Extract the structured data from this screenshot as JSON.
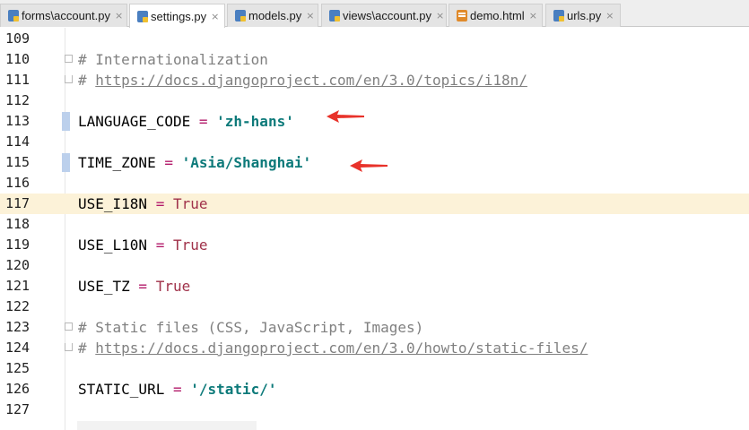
{
  "tabs": [
    {
      "label": "forms\\account.py",
      "icon": "python-file-icon",
      "active": false
    },
    {
      "label": "settings.py",
      "icon": "python-file-icon",
      "active": true
    },
    {
      "label": "models.py",
      "icon": "python-file-icon",
      "active": false
    },
    {
      "label": "views\\account.py",
      "icon": "python-file-icon",
      "active": false
    },
    {
      "label": "demo.html",
      "icon": "html-file-icon",
      "active": false
    },
    {
      "label": "urls.py",
      "icon": "python-file-icon",
      "active": false
    }
  ],
  "close_glyph": "×",
  "editor": {
    "current_line": 117,
    "lines": [
      {
        "number": "109"
      },
      {
        "number": "110",
        "comment": "# Internationalization"
      },
      {
        "number": "111",
        "comment_prefix": "# ",
        "url": "https://docs.djangoproject.com/en/3.0/topics/i18n/"
      },
      {
        "number": "112"
      },
      {
        "number": "113",
        "name": "LANGUAGE_CODE",
        "op": " = ",
        "string": "'zh-hans'"
      },
      {
        "number": "114"
      },
      {
        "number": "115",
        "name": "TIME_ZONE",
        "op": " = ",
        "string": "'Asia/Shanghai'"
      },
      {
        "number": "116"
      },
      {
        "number": "117",
        "name": "USE_I18N",
        "op": " = ",
        "keyword": "True"
      },
      {
        "number": "118"
      },
      {
        "number": "119",
        "name": "USE_L10N",
        "op": " = ",
        "keyword": "True"
      },
      {
        "number": "120"
      },
      {
        "number": "121",
        "name": "USE_TZ",
        "op": " = ",
        "keyword": "True"
      },
      {
        "number": "122"
      },
      {
        "number": "123",
        "comment": "# Static files (CSS, JavaScript, Images)"
      },
      {
        "number": "124",
        "comment_prefix": "# ",
        "url": "https://docs.djangoproject.com/en/3.0/howto/static-files/"
      },
      {
        "number": "125"
      },
      {
        "number": "126",
        "name": "STATIC_URL",
        "op": " = ",
        "string": "'/static/'"
      },
      {
        "number": "127"
      }
    ]
  },
  "colors": {
    "current_line_bg": "#fcf2d8",
    "string": "#0d7a7a",
    "keyword": "#a0324a",
    "comment": "#808080",
    "annotation_arrow": "#e8322a"
  }
}
